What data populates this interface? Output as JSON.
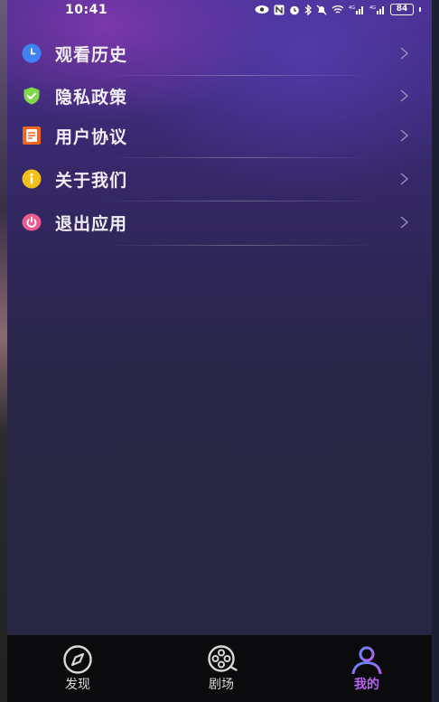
{
  "status_bar": {
    "time": "10:41",
    "battery": "84",
    "icons": [
      "eye-icon",
      "nfc-icon",
      "alarm-icon",
      "bluetooth-icon",
      "mute-icon",
      "wifi-icon",
      "signal-4g-icon",
      "signal-4g-icon",
      "battery-icon"
    ]
  },
  "menu": {
    "items": [
      {
        "label": "观看历史",
        "icon": "clock-icon",
        "color": "#3f82f5"
      },
      {
        "label": "隐私政策",
        "icon": "shield-check-icon",
        "color": "#7fd84a"
      },
      {
        "label": "用户协议",
        "icon": "document-icon",
        "color": "#f2661d"
      },
      {
        "label": "关于我们",
        "icon": "info-icon",
        "color": "#f3c21a"
      },
      {
        "label": "退出应用",
        "icon": "power-icon",
        "color": "#ec5b8f"
      }
    ]
  },
  "tabbar": {
    "tabs": [
      {
        "label": "发现",
        "icon": "compass-icon",
        "active": false
      },
      {
        "label": "剧场",
        "icon": "film-reel-icon",
        "active": false
      },
      {
        "label": "我的",
        "icon": "user-icon",
        "active": true
      }
    ],
    "active_color": "#b565f0"
  }
}
